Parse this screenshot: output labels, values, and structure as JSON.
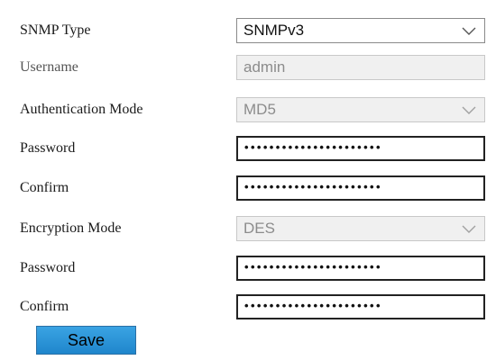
{
  "form": {
    "snmp_type": {
      "label": "SNMP Type",
      "value": "SNMPv3"
    },
    "username": {
      "label": "Username",
      "value": "admin"
    },
    "auth_mode": {
      "label": "Authentication Mode",
      "value": "MD5"
    },
    "auth_password": {
      "label": "Password",
      "value": "••••••••••••••••••••••"
    },
    "auth_confirm": {
      "label": "Confirm",
      "value": "••••••••••••••••••••••"
    },
    "enc_mode": {
      "label": "Encryption Mode",
      "value": "DES"
    },
    "enc_password": {
      "label": "Password",
      "value": "••••••••••••••••••••••"
    },
    "enc_confirm": {
      "label": "Confirm",
      "value": "••••••••••••••••••••••"
    }
  },
  "actions": {
    "save_label": "Save"
  },
  "icons": {
    "dropdown": "chevron-down-icon"
  },
  "colors": {
    "save_button": "#2A93D9",
    "disabled_field": "#F0F0F0"
  }
}
